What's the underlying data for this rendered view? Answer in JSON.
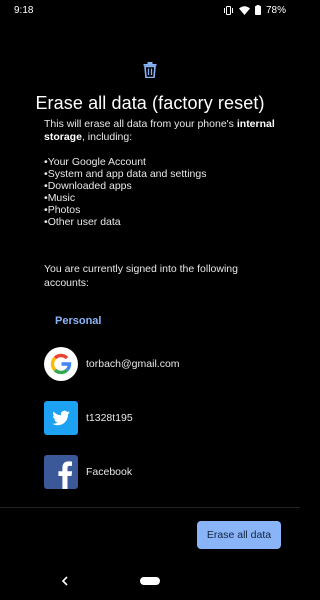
{
  "status_bar": {
    "time": "9:18",
    "battery": "78%"
  },
  "dialog": {
    "title": "Erase all data (factory reset)",
    "intro_prefix": "This will erase all data from your phone's",
    "intro_bold": "internal storage",
    "intro_suffix": ", including:",
    "items": [
      "Your Google Account",
      "System and app data and settings",
      "Downloaded apps",
      "Music",
      "Photos",
      "Other user data"
    ],
    "signed_in_text": "You are currently signed into the following accounts:",
    "section_label": "Personal",
    "accounts": [
      {
        "icon": "google-icon",
        "name": "torbach@gmail.com"
      },
      {
        "icon": "twitter-icon",
        "name": "t1328t195"
      },
      {
        "icon": "facebook-icon",
        "name": "Facebook"
      }
    ],
    "erase_button": "Erase all data"
  },
  "colors": {
    "accent": "#8ab4f8",
    "twitter": "#1da1f2",
    "facebook": "#3b5998",
    "background": "#000000"
  }
}
